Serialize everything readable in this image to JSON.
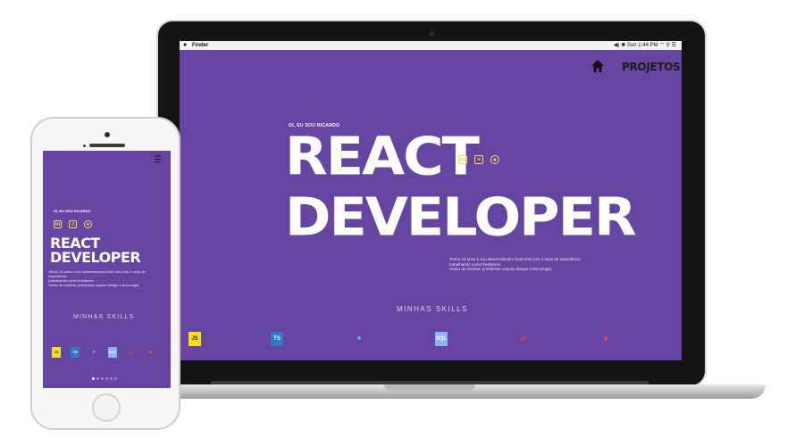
{
  "laptop": {
    "menubar": {
      "app": "Finder",
      "right": "◀) ✱ Sun 1:44 PM ⌔ ⚲ ☰"
    },
    "nav": {
      "projects": "PROJETOS"
    },
    "hero": {
      "hello": "OI, EU SOU RICARDO",
      "line1": "REACT",
      "line2": "DEVELOPER",
      "bio": [
        "Tenho 19 anos e sou desenvolvedor front-end com 2 anos de experiência",
        "trabalhando como freelancer.",
        "Gosto de resolver problemas usando design e tecnologia."
      ]
    },
    "skills_title": "MINHAS SKILLS",
    "skills": [
      {
        "label": "JS",
        "color": "#f7df1e",
        "fg": "#222222"
      },
      {
        "label": "TS",
        "color": "#3178c6",
        "fg": "#ffffff"
      },
      {
        "label": "⚛",
        "color": "transparent",
        "fg": "#61dafb"
      },
      {
        "label": "SQL",
        "color": "#8ab4f8",
        "fg": "#ffffff"
      },
      {
        "label": "git",
        "color": "transparent",
        "fg": "#e34c26"
      },
      {
        "label": "◆",
        "color": "transparent",
        "fg": "#f05033"
      }
    ]
  },
  "phone": {
    "hello": "OI, EU SOU RICARDO",
    "line1": "REACT",
    "line2": "DEVELOPER",
    "bio": [
      "Tenho 19 anos e sou desenvolvedor front-end com 2 anos de",
      "experiência",
      "trabalhando como freelancer.",
      "Gosto de resolver problemas usando design e tecnologia."
    ],
    "skills_title": "MINHAS SKILLS",
    "skills": [
      {
        "label": "JS",
        "color": "#f7df1e",
        "fg": "#222222"
      },
      {
        "label": "TS",
        "color": "#3178c6",
        "fg": "#ffffff"
      },
      {
        "label": "⚛",
        "color": "transparent",
        "fg": "#61dafb"
      },
      {
        "label": "SQL",
        "color": "#8ab4f8",
        "fg": "#ffffff"
      },
      {
        "label": "git",
        "color": "transparent",
        "fg": "#e34c26"
      },
      {
        "label": "◆",
        "color": "transparent",
        "fg": "#f05033"
      }
    ]
  },
  "colors": {
    "background": "#6645a2",
    "accent": "#f4e04d"
  }
}
